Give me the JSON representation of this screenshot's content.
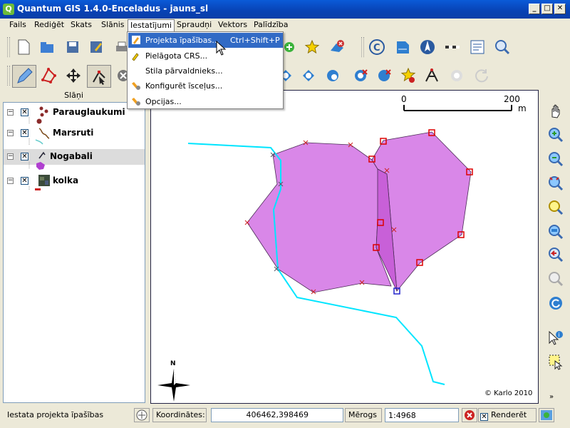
{
  "window": {
    "title": "Quantum GIS 1.4.0-Enceladus - jauns_sl",
    "app_icon_letter": "Q"
  },
  "menubar": {
    "items": [
      "Fails",
      "Rediģēt",
      "Skats",
      "Slānis",
      "Iestatījumi",
      "Spraudņi",
      "Vektors",
      "Palīdzība"
    ],
    "active": "Iestatījumi"
  },
  "dropdown": {
    "items": [
      {
        "label": "Projekta īpašības...",
        "shortcut": "Ctrl+Shift+P",
        "highlighted": true
      },
      {
        "label": "Pielāgota CRS...",
        "shortcut": ""
      },
      {
        "label": "Stila pārvaldnieks...",
        "shortcut": ""
      },
      {
        "label": "Konfigurēt īsceļus...",
        "shortcut": ""
      },
      {
        "label": "Opcijas...",
        "shortcut": ""
      }
    ]
  },
  "layers": {
    "header": "Slāņi",
    "items": [
      {
        "name": "Parauglaukumi",
        "checked": true,
        "icon": "point-layer-icon"
      },
      {
        "name": "Marsruti",
        "checked": true,
        "icon": "line-layer-icon"
      },
      {
        "name": "Nogabali",
        "checked": true,
        "icon": "polygon-layer-icon",
        "selected": true
      },
      {
        "name": "kolka",
        "checked": true,
        "icon": "raster-layer-icon"
      }
    ]
  },
  "map": {
    "scalebar": {
      "start": "0",
      "end": "200",
      "unit": "m"
    },
    "north_label": "N",
    "copyright": "© Karlo 2010",
    "polygon_fill": "#d987e8",
    "polygon_dark": "#c860d8",
    "line_color": "#00e5ff"
  },
  "statusbar": {
    "message": "Iestata projekta īpašības",
    "coords_label": "Koordinātes:",
    "coords_value": "406462,398469",
    "scale_label": "Mērogs",
    "scale_value": "1:4968",
    "render_label": "Renderēt"
  }
}
